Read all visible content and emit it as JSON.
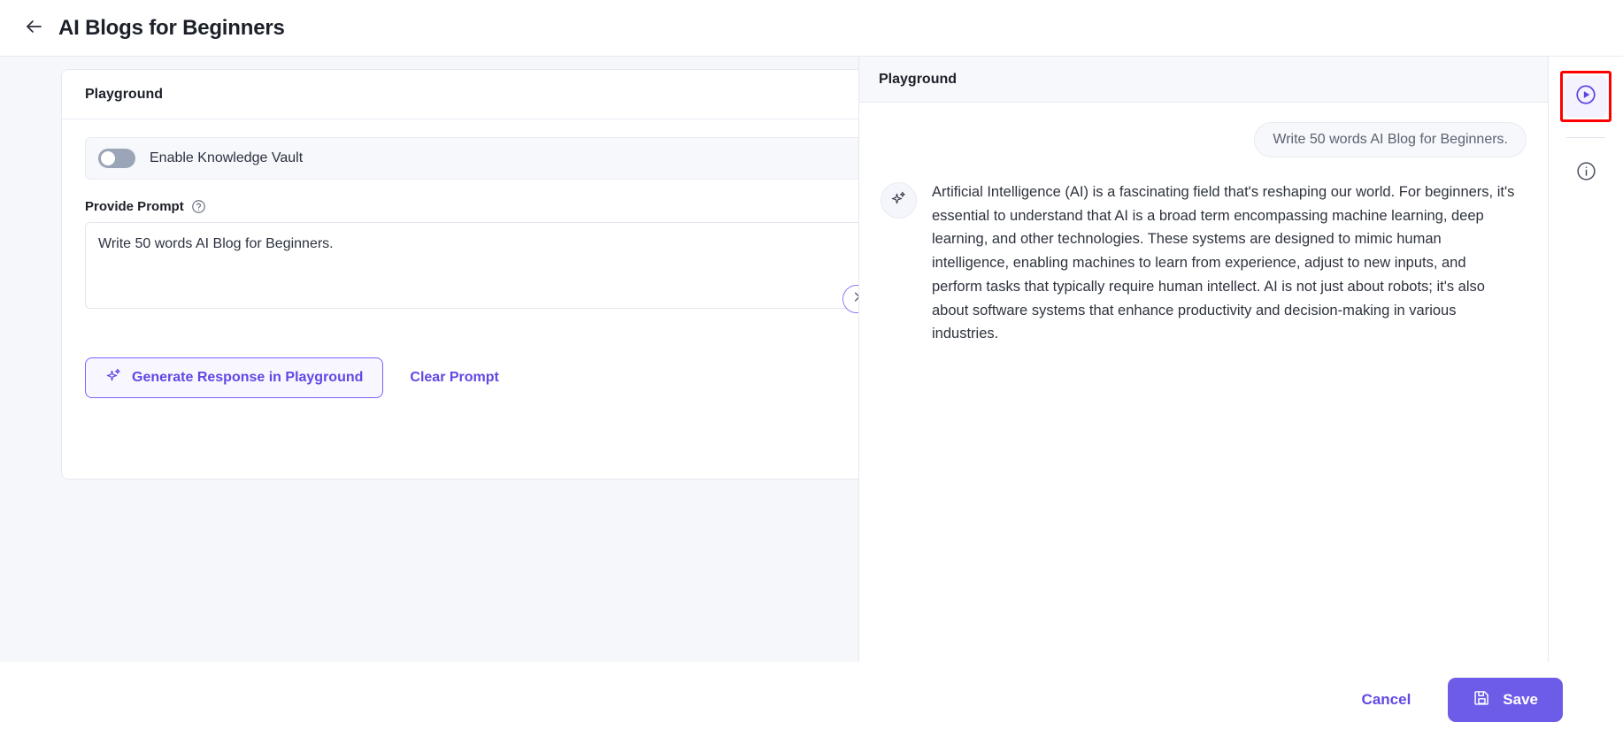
{
  "header": {
    "back_icon": "arrow-left-icon",
    "title": "AI Blogs for Beginners"
  },
  "left_panel": {
    "card_title": "Playground",
    "knowledge_vault": {
      "label": "Enable Knowledge Vault",
      "enabled": false
    },
    "prompt_field": {
      "label": "Provide Prompt",
      "help_icon": "question-circle-icon",
      "value": "Write 50 words AI Blog for Beginners.",
      "placeholder": "Write 50 words AI Blog for Beginners."
    },
    "generate_button": {
      "label": "Generate Response in Playground",
      "icon": "sparkle-icon"
    },
    "clear_button": {
      "label": "Clear Prompt"
    },
    "collapse_toggle_icon": "chevron-right-icon"
  },
  "right_panel": {
    "title": "Playground",
    "user_message": "Write 50 words AI Blog for Beginners.",
    "assistant_avatar_icon": "sparkle-icon",
    "assistant_message": "Artificial Intelligence (AI) is a fascinating field that's reshaping our world. For beginners, it's essential to understand that AI is a broad term encompassing machine learning, deep learning, and other technologies. These systems are designed to mimic human intelligence, enabling machines to learn from experience, adjust to new inputs, and perform tasks that typically require human intellect. AI is not just about robots; it's also about software systems that enhance productivity and decision-making in various industries."
  },
  "icon_rail": {
    "items": [
      {
        "icon": "play-circle-icon",
        "active": true,
        "highlighted": true
      },
      {
        "icon": "info-circle-icon",
        "active": false,
        "highlighted": false
      }
    ]
  },
  "footer": {
    "cancel_label": "Cancel",
    "save_label": "Save",
    "save_icon": "save-disk-icon"
  },
  "colors": {
    "accent": "#6c5ce7",
    "accent_text": "#6048e5",
    "highlight_box": "#ff0000",
    "page_bg": "#f6f7fb",
    "toggle_off": "#9aa5b8"
  }
}
